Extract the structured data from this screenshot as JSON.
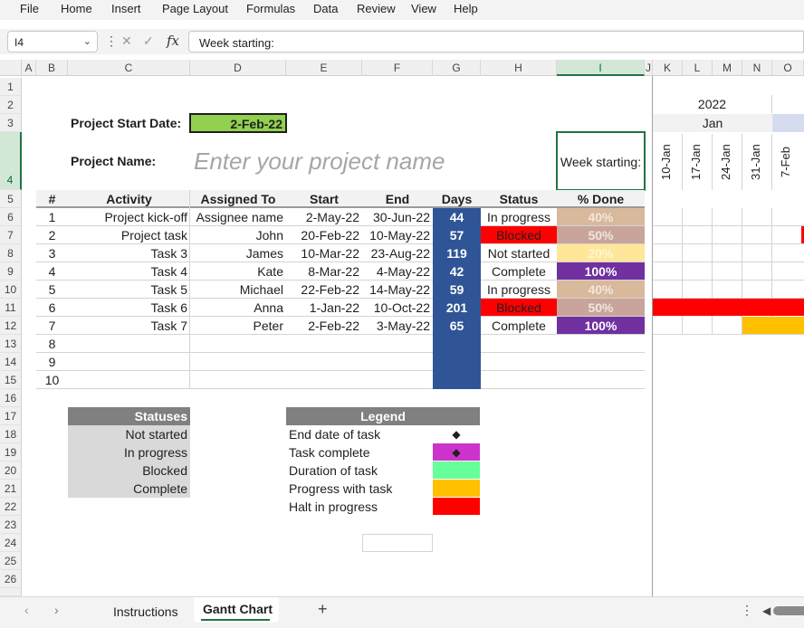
{
  "menu": [
    "File",
    "Home",
    "Insert",
    "Page Layout",
    "Formulas",
    "Data",
    "Review",
    "View",
    "Help"
  ],
  "formula_bar": {
    "name_box": "I4",
    "formula": "Week starting:"
  },
  "columns": [
    "A",
    "B",
    "C",
    "D",
    "E",
    "F",
    "G",
    "H",
    "I",
    "J",
    "K",
    "L",
    "M",
    "N",
    "O"
  ],
  "rows": [
    "1",
    "2",
    "3",
    "4",
    "5",
    "6",
    "7",
    "8",
    "9",
    "10",
    "11",
    "12",
    "13",
    "14",
    "15",
    "16",
    "17",
    "18",
    "19",
    "20",
    "21",
    "22",
    "23",
    "24",
    "25",
    "26"
  ],
  "sheet": {
    "start_label": "Project Start Date:",
    "start_value": "2-Feb-22",
    "name_label": "Project Name:",
    "name_placeholder": "Enter your project name",
    "week_label": "Week starting:",
    "gantt_year": "2022",
    "gantt_month": "Jan",
    "gantt_weeks": [
      "10-Jan",
      "17-Jan",
      "24-Jan",
      "31-Jan",
      "7-Feb"
    ],
    "headers": [
      "#",
      "Activity",
      "Assigned To",
      "Start",
      "End",
      "Days",
      "Status",
      "% Done"
    ],
    "tasks": [
      {
        "num": "1",
        "activity": "Project kick-off",
        "assigned": "Assignee name",
        "start": "2-May-22",
        "end": "30-Jun-22",
        "days": "44",
        "status": "In progress",
        "done": "40%"
      },
      {
        "num": "2",
        "activity": "Project task",
        "assigned": "John",
        "start": "20-Feb-22",
        "end": "10-May-22",
        "days": "57",
        "status": "Blocked",
        "done": "50%"
      },
      {
        "num": "3",
        "activity": "Task 3",
        "assigned": "James",
        "start": "10-Mar-22",
        "end": "23-Aug-22",
        "days": "119",
        "status": "Not started",
        "done": "20%"
      },
      {
        "num": "4",
        "activity": "Task 4",
        "assigned": "Kate",
        "start": "8-Mar-22",
        "end": "4-May-22",
        "days": "42",
        "status": "Complete",
        "done": "100%"
      },
      {
        "num": "5",
        "activity": "Task 5",
        "assigned": "Michael",
        "start": "22-Feb-22",
        "end": "14-May-22",
        "days": "59",
        "status": "In progress",
        "done": "40%"
      },
      {
        "num": "6",
        "activity": "Task 6",
        "assigned": "Anna",
        "start": "1-Jan-22",
        "end": "10-Oct-22",
        "days": "201",
        "status": "Blocked",
        "done": "50%"
      },
      {
        "num": "7",
        "activity": "Task 7",
        "assigned": "Peter",
        "start": "2-Feb-22",
        "end": "3-May-22",
        "days": "65",
        "status": "Complete",
        "done": "100%"
      }
    ],
    "empty_nums": [
      "8",
      "9",
      "10"
    ],
    "statuses_title": "Statuses",
    "statuses": [
      "Not started",
      "In progress",
      "Blocked",
      "Complete"
    ],
    "legend_title": "Legend",
    "legend": [
      {
        "label": "End date of task",
        "symbol": "◆"
      },
      {
        "label": "Task complete",
        "symbol": "◆"
      },
      {
        "label": "Duration of task",
        "symbol": ""
      },
      {
        "label": "Progress with task",
        "symbol": ""
      },
      {
        "label": "Halt in progress",
        "symbol": ""
      }
    ]
  },
  "sheet_tabs": [
    "Instructions",
    "Gantt Chart"
  ],
  "active_tab": "Gantt Chart",
  "colors": {
    "start_fill": "#92d050",
    "days_fill": "#2f5597",
    "in_progress": "#d9b99b",
    "blocked": "#ff0000",
    "not_started": "#ffe699",
    "complete": "#7030a0",
    "done_blocked": "#c9a49a",
    "header_grey": "#808080",
    "status_grey": "#d9d9d9",
    "legend_complete": "#cc33cc",
    "legend_duration": "#66ff99",
    "legend_progress": "#ffc000",
    "legend_halt": "#ff0000",
    "accent": "#217346"
  }
}
